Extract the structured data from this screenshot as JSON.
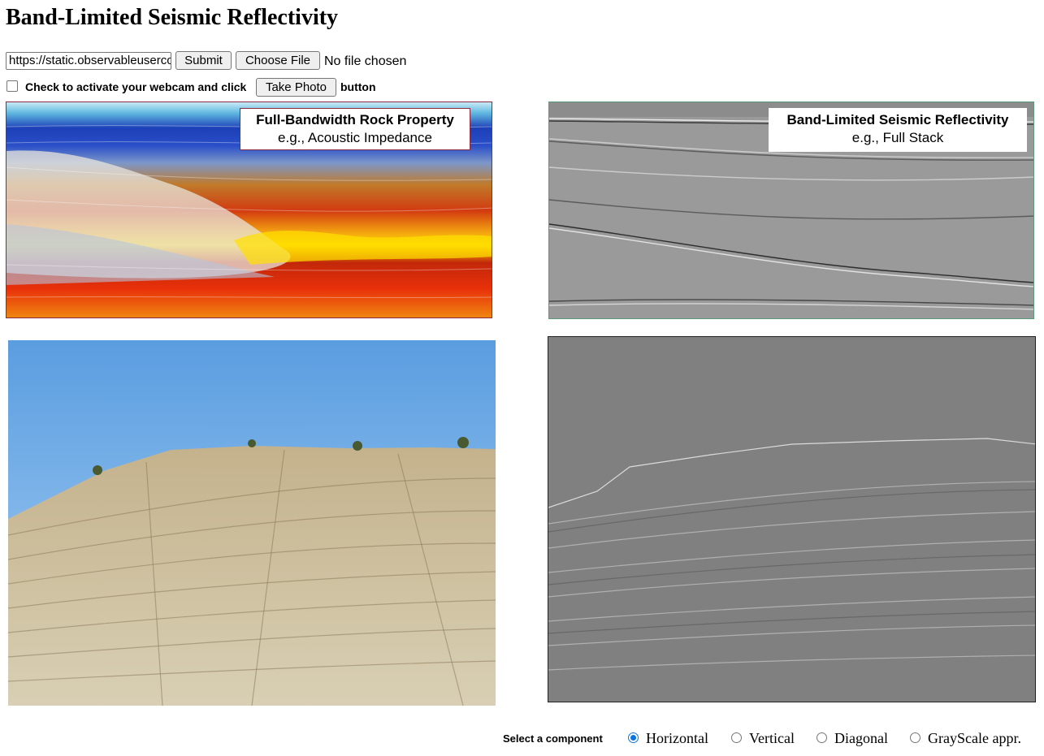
{
  "page": {
    "title": "Band-Limited Seismic Reflectivity"
  },
  "controls": {
    "url_value": "https://static.observableusercontent.com",
    "submit_label": "Submit",
    "choose_file_label": "Choose File",
    "no_file_text": "No file chosen",
    "webcam_checked": false,
    "webcam_label": "Check to activate your webcam and click",
    "take_photo_label": "Take Photo",
    "button_word": "button"
  },
  "panels": {
    "rock_property": {
      "title": "Full-Bandwidth Rock Property",
      "subtitle": "e.g., Acoustic Impedance"
    },
    "reflectivity": {
      "title": "Band-Limited Seismic Reflectivity",
      "subtitle": "e.g., Full Stack"
    },
    "photo": {
      "description_icon": "cliff-photo"
    },
    "output": {
      "description_icon": "edge-filtered-output"
    }
  },
  "component_selector": {
    "label": "Select a component",
    "options": [
      {
        "label": "Horizontal",
        "selected": true
      },
      {
        "label": "Vertical",
        "selected": false
      },
      {
        "label": "Diagonal",
        "selected": false
      },
      {
        "label": "GrayScale appr.",
        "selected": false
      }
    ]
  },
  "colors": {
    "radio_accent": "#0b74de",
    "panel_border_green": "#5a9a7a",
    "legend_border": "#8a2a40"
  }
}
